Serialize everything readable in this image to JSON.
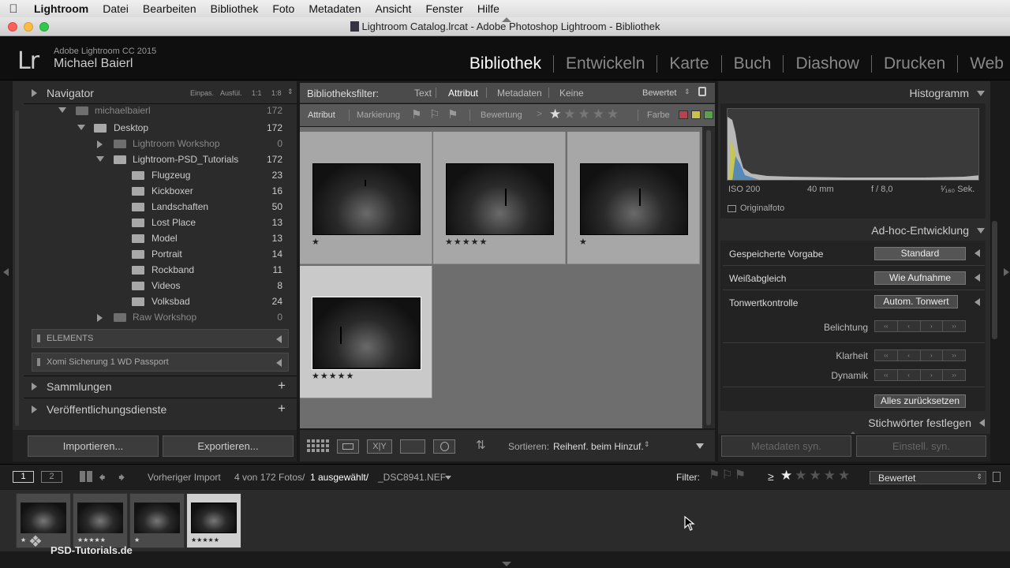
{
  "menubar": {
    "app": "Lightroom",
    "items": [
      "Datei",
      "Bearbeiten",
      "Bibliothek",
      "Foto",
      "Metadaten",
      "Ansicht",
      "Fenster",
      "Hilfe"
    ]
  },
  "window": {
    "title": "Lightroom Catalog.lrcat - Adobe Photoshop Lightroom - Bibliothek"
  },
  "identity": {
    "logo": "Lr",
    "version": "Adobe Lightroom CC 2015",
    "user": "Michael Baierl"
  },
  "modules": [
    "Bibliothek",
    "Entwickeln",
    "Karte",
    "Buch",
    "Diashow",
    "Drucken",
    "Web"
  ],
  "navigator": {
    "title": "Navigator",
    "zoom_options": [
      "Einpas.",
      "Ausfül.",
      "1:1",
      "1:8"
    ]
  },
  "folders": {
    "partial_top": {
      "name": "michaelbaierl",
      "count": "172"
    },
    "rows": [
      {
        "name": "Desktop",
        "count": "172"
      },
      {
        "name": "Lightroom Workshop",
        "count": "0"
      },
      {
        "name": "Lightroom-PSD_Tutorials",
        "count": "172"
      },
      {
        "name": "Flugzeug",
        "count": "23"
      },
      {
        "name": "Kickboxer",
        "count": "16"
      },
      {
        "name": "Landschaften",
        "count": "50"
      },
      {
        "name": "Lost Place",
        "count": "13"
      },
      {
        "name": "Model",
        "count": "13"
      },
      {
        "name": "Portrait",
        "count": "14"
      },
      {
        "name": "Rockband",
        "count": "11"
      },
      {
        "name": "Videos",
        "count": "8"
      },
      {
        "name": "Volksbad",
        "count": "24"
      },
      {
        "name": "Raw Workshop",
        "count": "0"
      }
    ],
    "volumes": [
      "ELEMENTS",
      "Xomi Sicherung 1 WD Passport"
    ]
  },
  "left_panels": [
    "Sammlungen",
    "Veröffentlichungsdienste"
  ],
  "left_buttons": {
    "import": "Importieren...",
    "export": "Exportieren..."
  },
  "filterbar": {
    "label": "Bibliotheksfilter:",
    "tabs": [
      "Text",
      "Attribut",
      "Metadaten",
      "Keine"
    ],
    "preset": "Bewertet",
    "attribut_label": "Attribut",
    "markierung": "Markierung",
    "bewertung": "Bewertung",
    "farbe": "Farbe",
    "colors": [
      "#b8434e",
      "#c9c24a",
      "#5aa14c"
    ]
  },
  "grid": {
    "cells": [
      {
        "rating": 1
      },
      {
        "rating": 5
      },
      {
        "rating": 1
      },
      {
        "rating": 5,
        "selected": true
      }
    ]
  },
  "toolbar": {
    "sort_label": "Sortieren:",
    "sort_value": "Reihenf. beim Hinzuf."
  },
  "histogram": {
    "title": "Histogramm",
    "iso": "ISO 200",
    "focal": "40 mm",
    "aperture": "f / 8,0",
    "shutter": "¹⁄₁₆₀ Sek.",
    "original": "Originalfoto"
  },
  "quick_develop": {
    "title": "Ad-hoc-Entwicklung",
    "preset_label": "Gespeicherte Vorgabe",
    "preset_value": "Standard",
    "wb_label": "Weißabgleich",
    "wb_value": "Wie Aufnahme",
    "tone_label": "Tonwertkontrolle",
    "auto_tone": "Autom. Tonwert",
    "belichtung": "Belichtung",
    "klarheit": "Klarheit",
    "dynamik": "Dynamik",
    "reset": "Alles zurücksetzen"
  },
  "keywords": {
    "title": "Stichwörter festlegen"
  },
  "right_buttons": {
    "sync_meta": "Metadaten syn.",
    "sync_settings": "Einstell. syn."
  },
  "filmbar": {
    "screen1": "1",
    "screen2": "2",
    "source": "Vorheriger Import",
    "count": "4 von 172 Fotos/",
    "selected": "1 ausgewählt/",
    "file": "_DSC8941.NEF",
    "filter_label": "Filter:",
    "gte": "≥",
    "filter_preset": "Bewertet"
  },
  "filmstrip": [
    {
      "stars": "★"
    },
    {
      "stars": "★★★★★"
    },
    {
      "stars": "★"
    },
    {
      "stars": "★★★★★",
      "selected": true
    }
  ],
  "watermark": "PSD-Tutorials.de"
}
